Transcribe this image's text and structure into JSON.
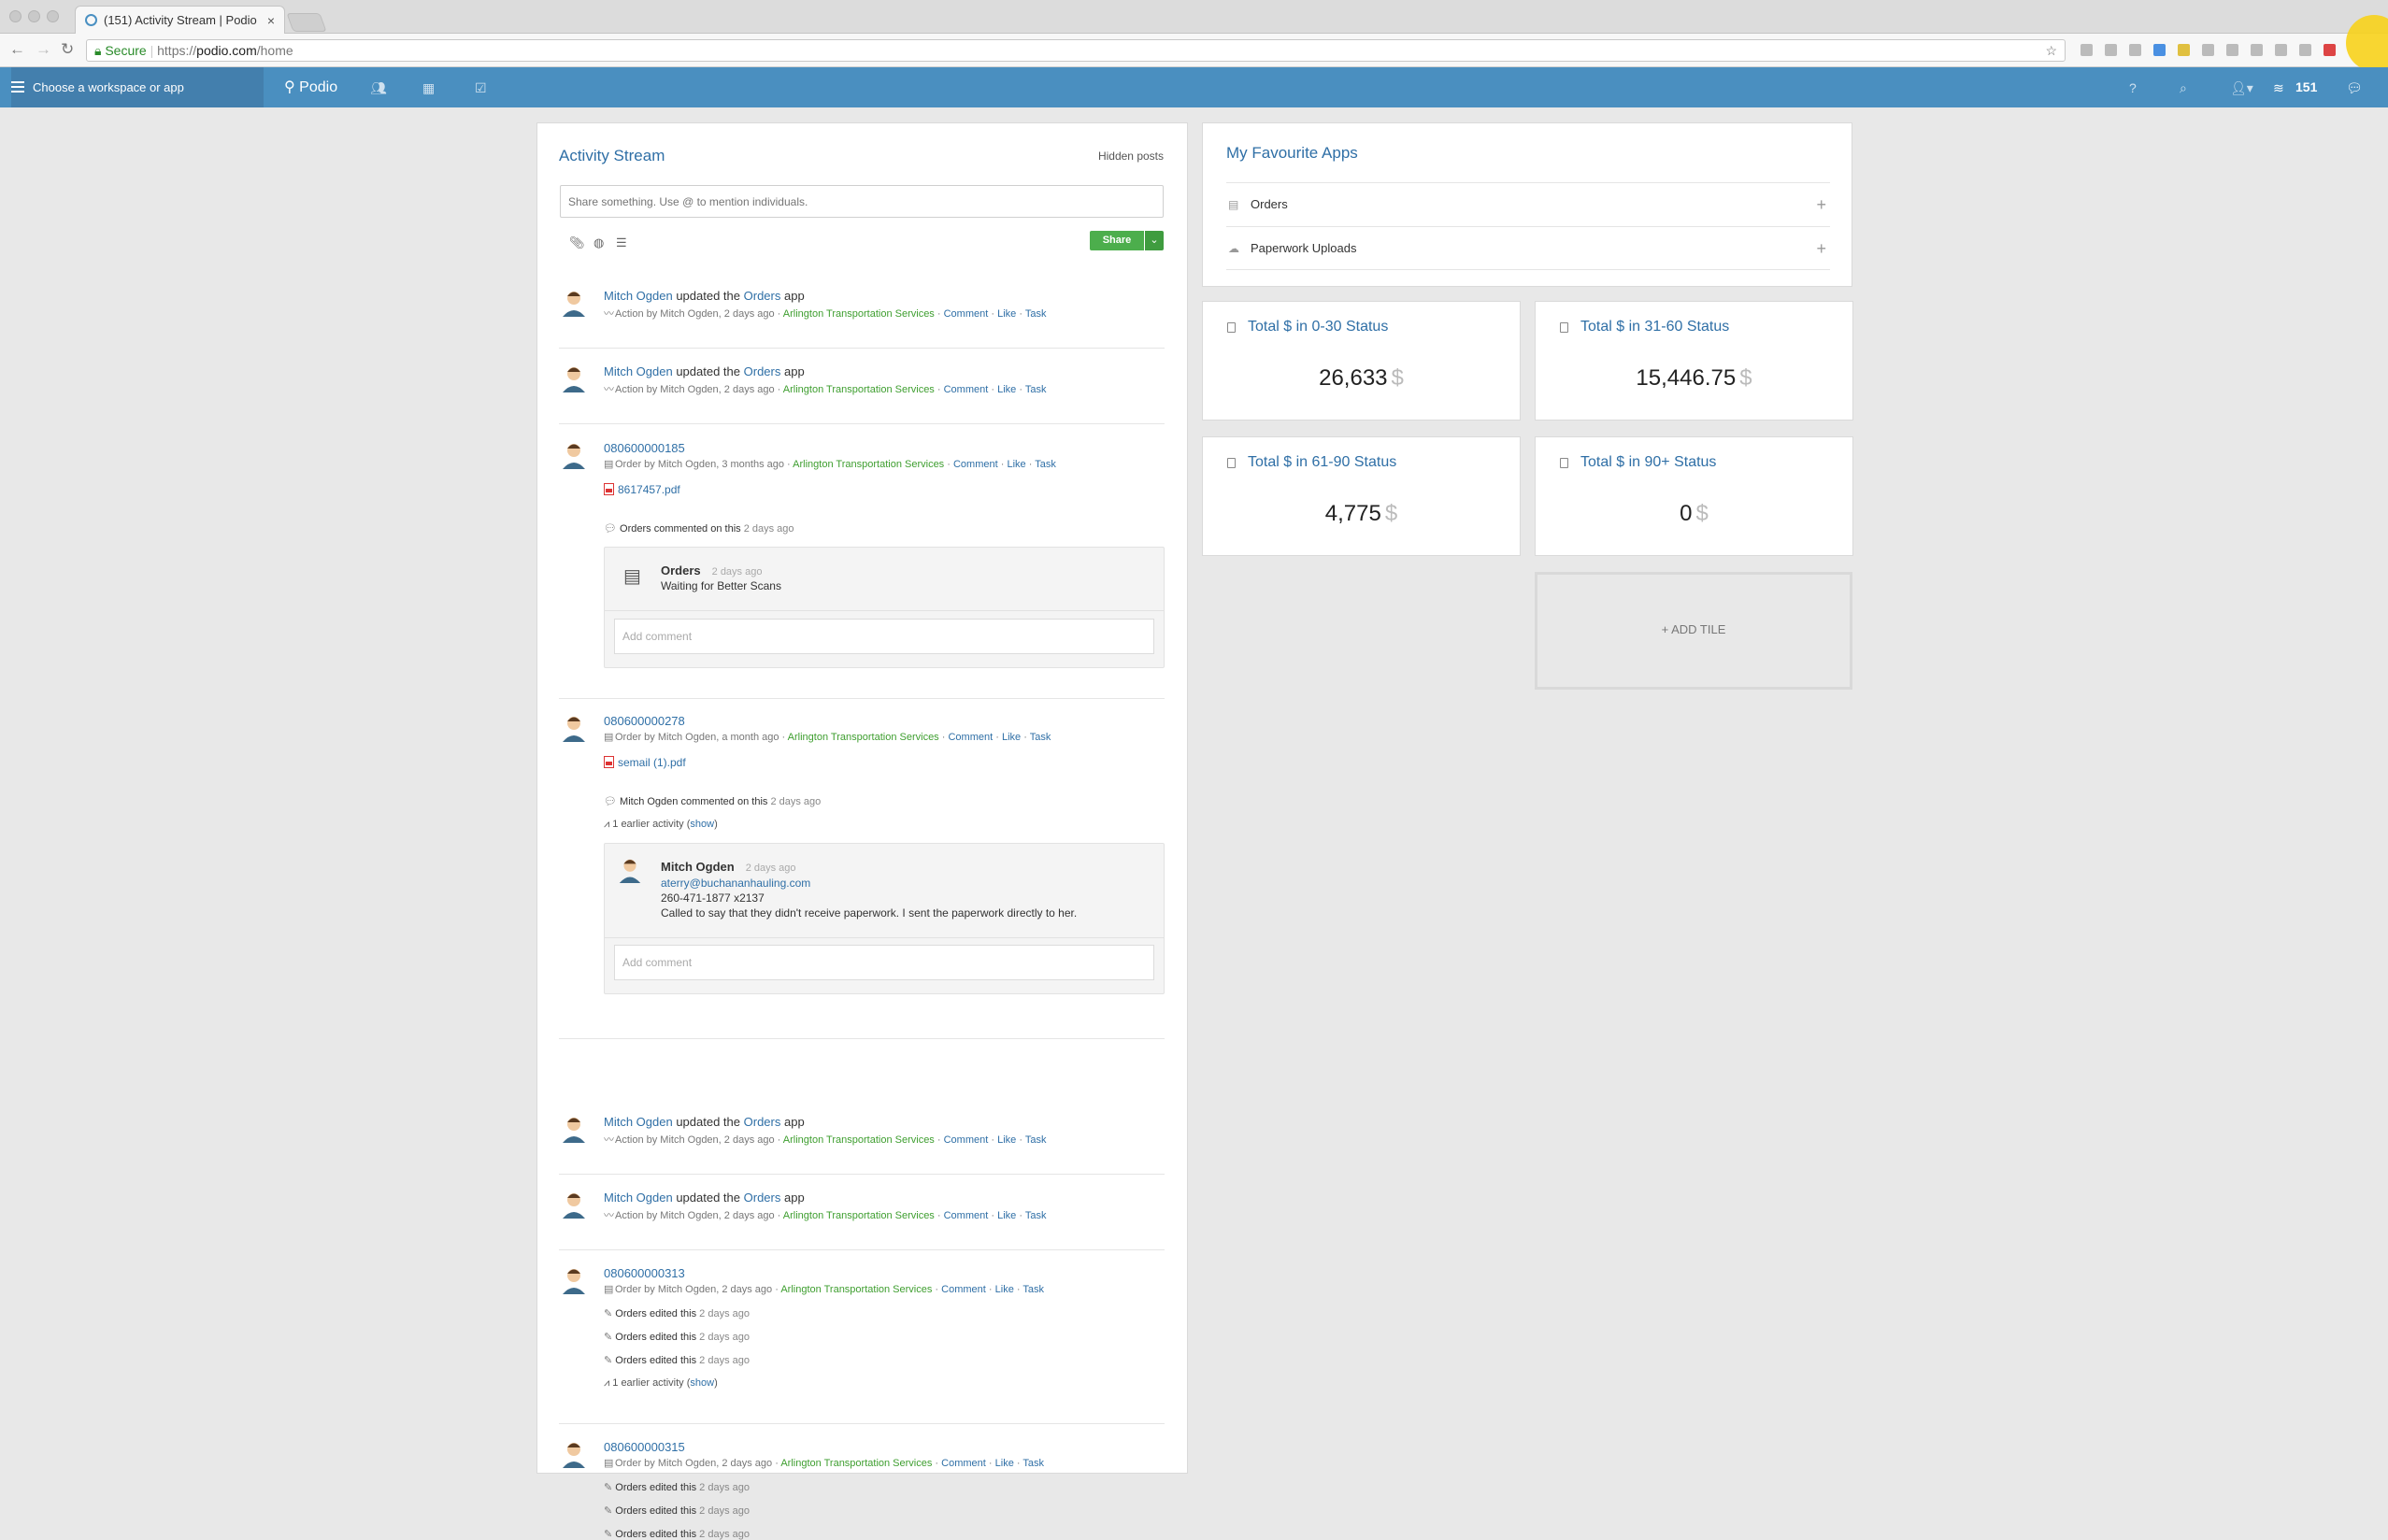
{
  "browser": {
    "tab_title": "(151) Activity Stream | Podio",
    "close": "×",
    "secure": "Secure",
    "url_scheme": "https://",
    "url_domain": "podio.com",
    "url_path": "/home"
  },
  "topbar": {
    "workspace": "Choose a workspace or app",
    "brand": "Podio",
    "help": "?",
    "notifications": "151"
  },
  "stream": {
    "title": "Activity Stream",
    "hidden": "Hidden posts",
    "share_placeholder": "Share something. Use @ to mention individuals.",
    "share_button": "Share",
    "items": [
      {
        "user": "Mitch Ogden",
        "verb": "updated the",
        "app": "Orders",
        "suffix": "app",
        "meta": "Action by Mitch Ogden, 2 days ago ·",
        "ws": "Arlington Transportation Services"
      },
      {
        "user": "Mitch Ogden",
        "verb": "updated the",
        "app": "Orders",
        "suffix": "app",
        "meta": "Action by Mitch Ogden, 2 days ago ·",
        "ws": "Arlington Transportation Services"
      },
      {
        "title": "080600000185",
        "meta": "Order by Mitch Ogden, 3 months ago ·",
        "ws": "Arlington Transportation Services",
        "file": "8617457.pdf",
        "activity_who": "Orders commented on this",
        "activity_when": "2 days ago",
        "comment_author": "Orders",
        "comment_time": "2 days ago",
        "comment_text": "Waiting for Better Scans",
        "add_comment": "Add comment"
      },
      {
        "title": "080600000278",
        "meta": "Order by Mitch Ogden, a month ago ·",
        "ws": "Arlington Transportation Services",
        "file": "semail (1).pdf",
        "activity_who": "Mitch Ogden commented on this",
        "activity_when": "2 days ago",
        "earlier": "1 earlier activity (",
        "show": "show",
        "comment_author": "Mitch Ogden",
        "comment_time": "2 days ago",
        "comment_email": "aterry@buchananhauling.com",
        "comment_phone": "260-471-1877 x2137",
        "comment_text": "Called to say that they didn't receive paperwork. I sent the paperwork directly to her.",
        "add_comment": "Add comment"
      },
      {
        "user": "Mitch Ogden",
        "verb": "updated the",
        "app": "Orders",
        "suffix": "app",
        "meta": "Action by Mitch Ogden, 2 days ago ·",
        "ws": "Arlington Transportation Services"
      },
      {
        "user": "Mitch Ogden",
        "verb": "updated the",
        "app": "Orders",
        "suffix": "app",
        "meta": "Action by Mitch Ogden, 2 days ago ·",
        "ws": "Arlington Transportation Services"
      },
      {
        "title": "080600000313",
        "meta": "Order by Mitch Ogden, 2 days ago ·",
        "ws": "Arlington Transportation Services",
        "edit": "Orders edited this",
        "edit_when": "2 days ago",
        "earlier": "1 earlier activity (",
        "show": "show"
      },
      {
        "title": "080600000315",
        "meta": "Order by Mitch Ogden, 2 days ago ·",
        "ws": "Arlington Transportation Services",
        "edit": "Orders edited this",
        "edit_when": "2 days ago"
      }
    ],
    "actions": {
      "comment": "Comment",
      "like": "Like",
      "task": "Task",
      "sep": "·"
    }
  },
  "favourites": {
    "title": "My Favourite Apps",
    "apps": [
      "Orders",
      "Paperwork Uploads"
    ],
    "plus": "+"
  },
  "tiles": [
    {
      "title": "Total $ in 0-30 Status",
      "value": "26,633",
      "currency": "$"
    },
    {
      "title": "Total $ in 31-60 Status",
      "value": "15,446.75",
      "currency": "$"
    },
    {
      "title": "Total $ in 61-90 Status",
      "value": "4,775",
      "currency": "$"
    },
    {
      "title": "Total $ in 90+ Status",
      "value": "0",
      "currency": "$"
    }
  ],
  "add_tile": "+ ADD TILE"
}
